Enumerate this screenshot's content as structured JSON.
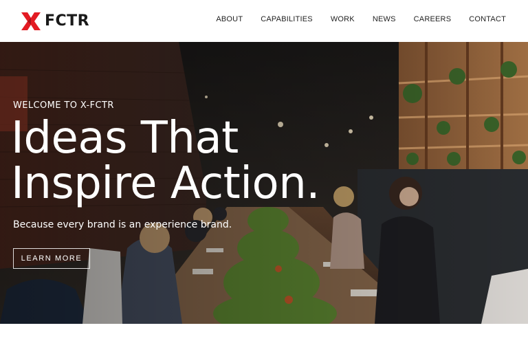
{
  "brand": {
    "logo_text": "FCTR",
    "logo_color": "#e31b23"
  },
  "nav": {
    "items": [
      {
        "label": "ABOUT"
      },
      {
        "label": "CAPABILITIES"
      },
      {
        "label": "WORK"
      },
      {
        "label": "NEWS"
      },
      {
        "label": "CAREERS"
      },
      {
        "label": "CONTACT"
      }
    ]
  },
  "hero": {
    "eyebrow": "WELCOME TO X-FCTR",
    "headline_line1": "Ideas That",
    "headline_line2": "Inspire Action.",
    "subtext": "Because every brand is an experience brand.",
    "cta_label": "LEARN MORE"
  }
}
